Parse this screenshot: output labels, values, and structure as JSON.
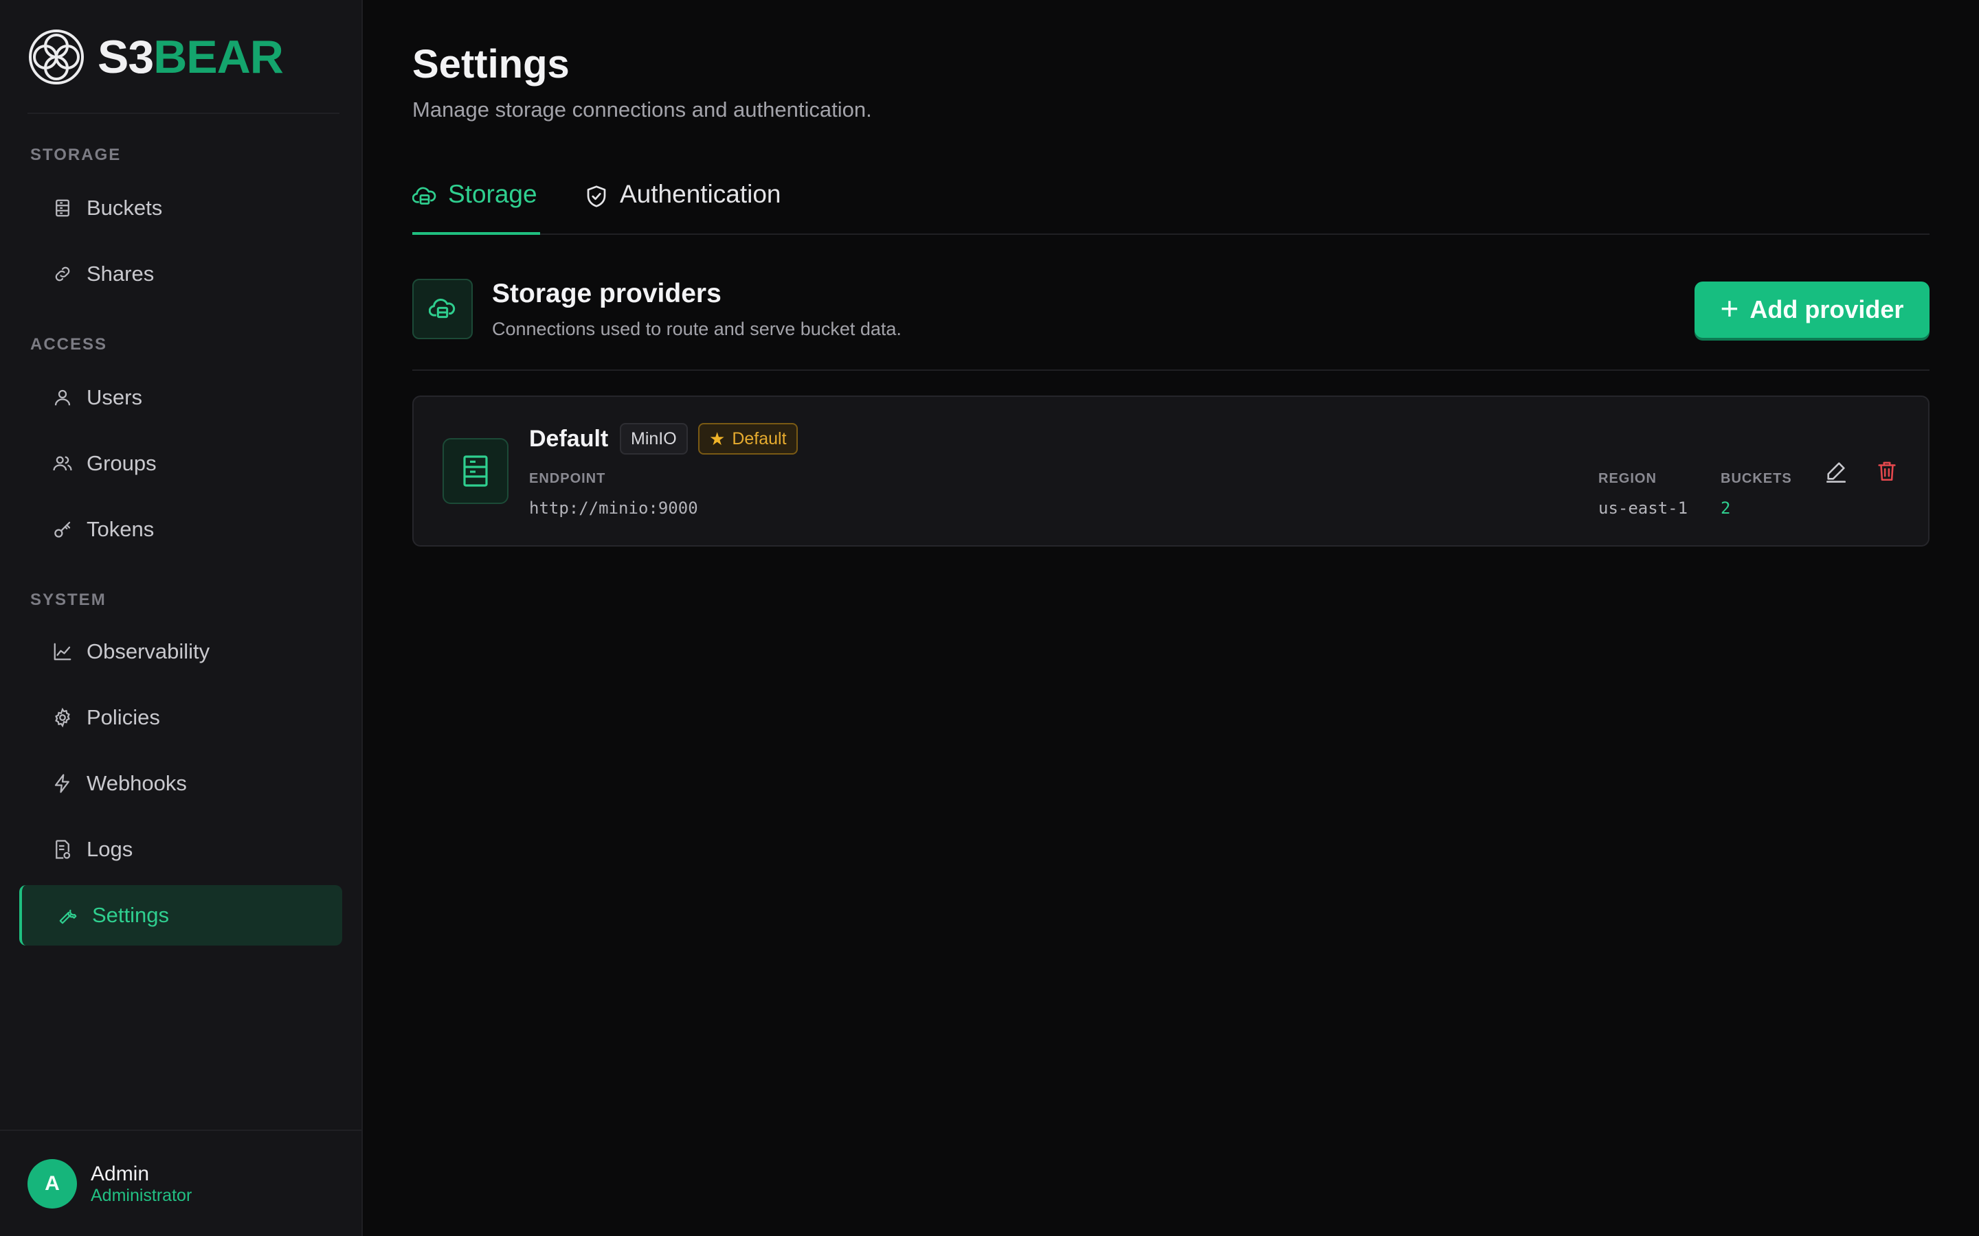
{
  "brand": {
    "prefix": "S3",
    "suffix": "BEAR",
    "logo_icon": "celtic-knot-logo"
  },
  "sidebar": {
    "sections": [
      {
        "title": "STORAGE"
      },
      {
        "title": "ACCESS"
      },
      {
        "title": "SYSTEM"
      }
    ],
    "items": [
      {
        "label": "Buckets",
        "icon": "bucket-icon"
      },
      {
        "label": "Shares",
        "icon": "link-icon"
      },
      {
        "label": "Users",
        "icon": "user-icon"
      },
      {
        "label": "Groups",
        "icon": "users-icon"
      },
      {
        "label": "Tokens",
        "icon": "key-icon"
      },
      {
        "label": "Observability",
        "icon": "chart-line-icon"
      },
      {
        "label": "Policies",
        "icon": "gear-icon"
      },
      {
        "label": "Webhooks",
        "icon": "bolt-icon"
      },
      {
        "label": "Logs",
        "icon": "log-icon"
      },
      {
        "label": "Settings",
        "icon": "wrench-icon",
        "active": true
      }
    ]
  },
  "user": {
    "initial": "A",
    "name": "Admin",
    "role": "Administrator"
  },
  "page": {
    "title": "Settings",
    "subtitle": "Manage storage connections and authentication."
  },
  "tabs": [
    {
      "label": "Storage",
      "icon": "cloud-storage-icon",
      "active": true
    },
    {
      "label": "Authentication",
      "icon": "shield-check-icon",
      "active": false
    }
  ],
  "storage": {
    "title": "Storage providers",
    "subtitle": "Connections used to route and serve bucket data.",
    "add_label": "Add provider",
    "providers": [
      {
        "name": "Default",
        "type": "MinIO",
        "default_badge": "Default",
        "endpoint_label": "ENDPOINT",
        "endpoint": "http://minio:9000",
        "region_label": "REGION",
        "region": "us-east-1",
        "buckets_label": "BUCKETS",
        "buckets": "2"
      }
    ]
  },
  "colors": {
    "accent": "#1fbf80",
    "background": "#0a0a0b",
    "sidebar": "#151518",
    "warning": "#e7ac2f",
    "danger": "#e5484d"
  }
}
